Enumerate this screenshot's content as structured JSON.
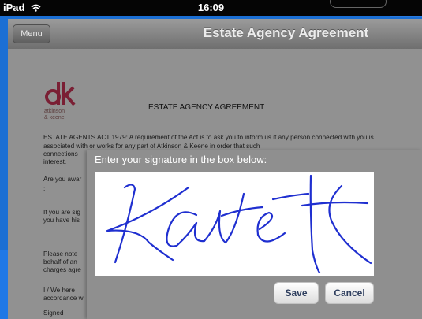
{
  "status_bar": {
    "device": "iPad",
    "time": "16:09"
  },
  "navbar": {
    "menu_label": "Menu",
    "title": "Estate Agency Agreement"
  },
  "document": {
    "logo_line1": "atkinson",
    "logo_line2": "& keene",
    "heading": "ESTATE AGENCY AGREEMENT",
    "para1": "ESTATE AGENTS ACT 1979:  A requirement of the Act is to ask you to inform us if any person connected with you is associated with or works for any part of Atkinson & Keene in order that such",
    "para1_cont_a": "connections",
    "para1_cont_b": "interest.",
    "para2_a": "Are you awar",
    "para2_b": ":",
    "para3_a": "If you are sig",
    "para3_b": "you have his",
    "para4_a": "Please note",
    "para4_b": "behalf of an",
    "para4_c": "charges agre",
    "para5_a": "I / We here",
    "para5_b": "accordance w",
    "signed": "Signed"
  },
  "signature_dialog": {
    "prompt": "Enter your signature in the box below:",
    "save_label": "Save",
    "cancel_label": "Cancel",
    "ink_color": "#1f2fd0"
  }
}
